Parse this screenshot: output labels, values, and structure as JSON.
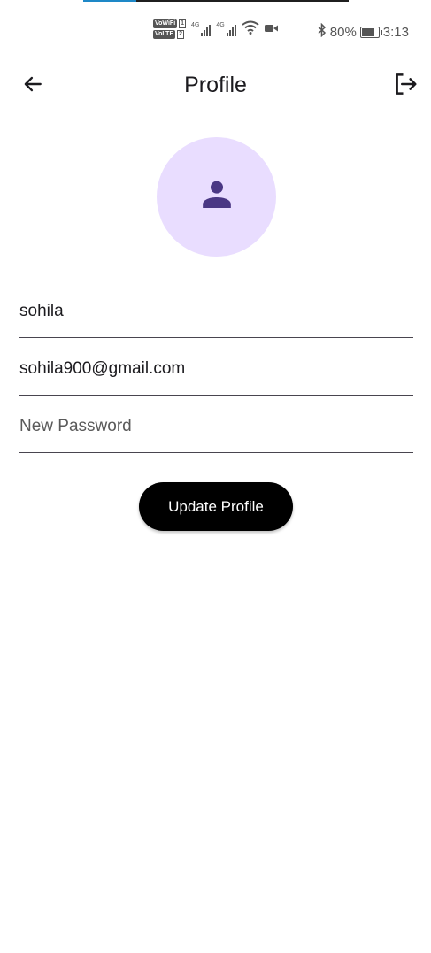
{
  "progress": {
    "fraction": 0.2,
    "fill_color": "#1e88c7"
  },
  "status_bar": {
    "chips": [
      {
        "label": "VoWiFi",
        "num": "1"
      },
      {
        "label": "VoLTE",
        "num": "2"
      }
    ],
    "signal_labels": [
      "4G",
      "4G"
    ],
    "bluetooth_icon": "bluetooth-icon",
    "battery_percent": "80%",
    "battery_level": 0.8,
    "time": "3:13"
  },
  "app_bar": {
    "title": "Profile",
    "back_icon": "arrow-back-icon",
    "logout_icon": "logout-icon"
  },
  "avatar": {
    "icon": "person-icon",
    "bg_color": "#e9ddff",
    "icon_color": "#4a3784"
  },
  "form": {
    "name_value": "sohila",
    "email_value": "sohila900@gmail.com",
    "password_value": "",
    "password_placeholder": "New Password",
    "update_label": "Update Profile"
  }
}
